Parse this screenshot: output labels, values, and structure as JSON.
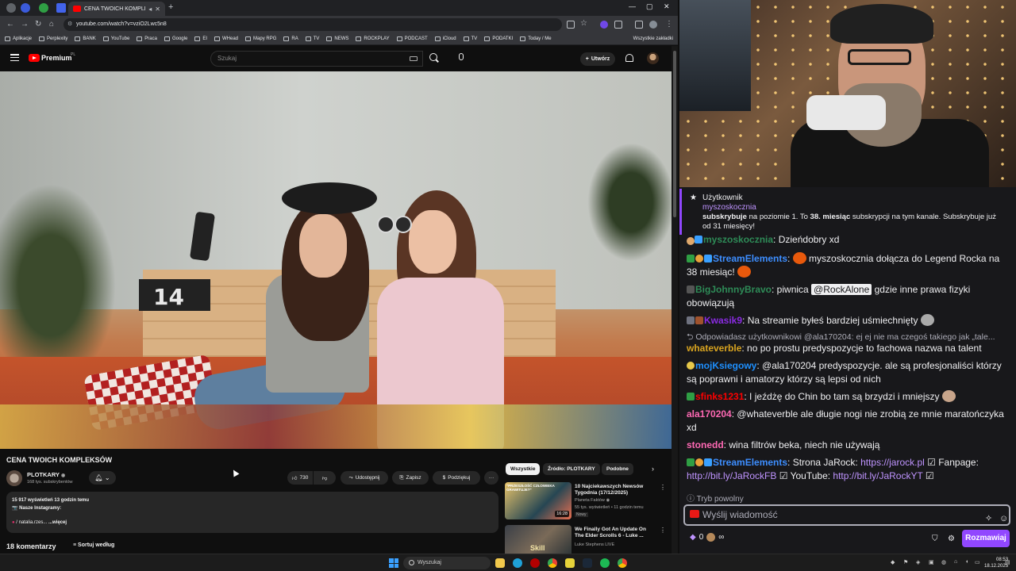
{
  "browser": {
    "tab_title": "CENA TWOICH KOMPLEKSÓ",
    "url": "youtube.com/watch?v=vziO2Lwc5n8",
    "bookmarks": [
      "Aplikacje",
      "Perplexity",
      "BANK",
      "YouTube",
      "Praca",
      "Google",
      "EI",
      "WHead",
      "Mapy RPG",
      "RA",
      "TV",
      "NEWS",
      "ROCKPLAY",
      "PODCAST",
      "iCloud",
      "TV",
      "PODATKI",
      "Today / Me"
    ],
    "all_bookmarks": "Wszystkie zakładki"
  },
  "youtube": {
    "logo_text": "Premium",
    "logo_country": "PL",
    "search_placeholder": "Szukaj",
    "create_label": "Utwórz",
    "video_title": "CENA TWOICH KOMPLEKSÓW",
    "channel_name": "PLOTKARY",
    "channel_subs": "168 tys. subskrybentów",
    "like_count": "730",
    "share_label": "Udostępnij",
    "save_label": "Zapisz",
    "thanks_label": "Podziękuj",
    "views_line": "15 917 wyświetleń  13 godzin temu",
    "desc_instagram": "📷 Nasze Instagramy:",
    "desc_handle": "/ natalia.rzes...",
    "desc_more": "...więcej",
    "comments_count": "18 komentarzy",
    "sort_label": "Sortuj według",
    "clock_digits": "14",
    "chips": [
      "Wszystkie",
      "Źródło: PLOTKARY",
      "Podobne"
    ],
    "recommendations": [
      {
        "title": "10 Najciekawszych Newsów Tygodnia (17/12/2025)",
        "channel": "Planeta Faktów",
        "meta": "55 tys. wyświetleń • 11 godzin temu",
        "badge": "Nowy",
        "duration": "16:28",
        "thumb_text": "\"PRZESZŁOŚĆ CZŁOWIEKA GRAWITUJE?\""
      },
      {
        "title": "We Finally Got An Update On The Elder Scrolls 6 - Luke ...",
        "channel": "Luke Stephens LIVE",
        "thumb_text": "Skill"
      }
    ]
  },
  "chat": {
    "sub_label": "Użytkownik",
    "sub_user": "myszoskocznia",
    "sub_text_1": "subskrybuje",
    "sub_text_2": " na poziomie 1. To ",
    "sub_text_3": "38. miesiąc",
    "sub_text_4": " subskrypcji na tym kanale. Subskrybuje już od 31 miesięcy!",
    "messages": [
      {
        "user": "myszoskocznia",
        "color": "#2e8b57",
        "text": ": Dzieńdobry xd"
      },
      {
        "user": "StreamElements",
        "color": "#3d8eff",
        "text": ": ",
        "text2": " myszoskocznia dołącza do Legend Rocka na 38 miesiąc! "
      },
      {
        "user": "BigJohnnyBravo",
        "color": "#1e90ff",
        "text": ": piwnica ",
        "mention": "@RockAlone",
        "text2": " gdzie inne prawa fizyki obowiązują"
      },
      {
        "user": "Kwasik9",
        "color": "#8a2be2",
        "text": ": Na streamie byłeś bardziej uśmiechnięty "
      },
      {
        "user": "whateverble",
        "color": "#daa520",
        "text": ": no po prostu predyspozycje to fachowa nazwa na talent"
      },
      {
        "user": "mojKsiegowy",
        "color": "#1e90ff",
        "text": ": @ala170204 predyspozycje. ale są profesjonaliści którzy są poprawni i amatorzy którzy są lepsi od nich"
      },
      {
        "user": "sfinks1231",
        "color": "#ff0000",
        "text": ": I jeźdżę do Chin bo tam są brzydzi i mniejszy "
      },
      {
        "user": "ala170204",
        "color": "#ff69b4",
        "text": ": @whateverble ale długie nogi nie zrobią ze mnie maratończyka xd"
      },
      {
        "user": "stonedd",
        "color": "#ff69b4",
        "text": ": wina filtrów beka, niech nie używają"
      },
      {
        "user": "StreamElements",
        "color": "#3d8eff",
        "text": ": Strona JaRock: ",
        "link1": "https://jarock.pl",
        "text2": " ☑ Fanpage: ",
        "link2": "http://bit.ly/JaRockFB",
        "text3": " ☑ YouTube: ",
        "link3": "http://bit.ly/JaRockYT",
        "text4": " ☑"
      }
    ],
    "reply_text": "Odpowiadasz użytkownikowi @ala170204: ej ej nie ma czegoś takiego jak „tale...",
    "slow_mode": "Tryb powolny",
    "input_placeholder": "Wyślij wiadomość",
    "bits": "0",
    "talk_button": "Rozmawiaj"
  },
  "taskbar": {
    "search": "Wyszukaj",
    "time": "08:53",
    "date": "18.12.2025"
  }
}
